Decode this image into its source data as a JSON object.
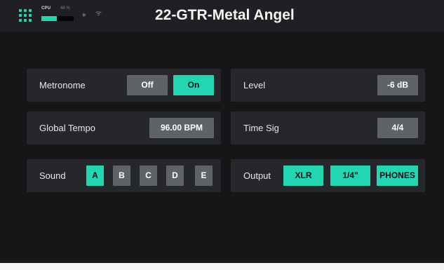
{
  "status_bar": {
    "cpu": {
      "label": "CPU",
      "percent_text": "48 %",
      "fill_fraction": 0.48
    },
    "icons": [
      "apps-grid-icon",
      "bluetooth-icon",
      "wifi-icon"
    ],
    "bluetooth_glyph": "∗",
    "wifi_glyph": "ᯤ",
    "preset_title": "22-GTR-Metal Angel"
  },
  "colors": {
    "accent": "#22d6b1",
    "panel": "#25272b",
    "button_off": "#5f6266",
    "background": "#151618"
  },
  "settings": {
    "metronome": {
      "label": "Metronome",
      "off_label": "Off",
      "on_label": "On",
      "selected": "On"
    },
    "level": {
      "label": "Level",
      "value": "-6 dB"
    },
    "global_tempo": {
      "label": "Global Tempo",
      "value": "96.00 BPM"
    },
    "time_sig": {
      "label": "Time Sig",
      "value": "4/4"
    },
    "sound": {
      "label": "Sound",
      "options": [
        "A",
        "B",
        "C",
        "D",
        "E"
      ],
      "selected": "A"
    },
    "output": {
      "label": "Output",
      "options": [
        "XLR",
        "1/4\"",
        "PHONES"
      ],
      "selected": [
        "XLR",
        "1/4\"",
        "PHONES"
      ]
    }
  }
}
